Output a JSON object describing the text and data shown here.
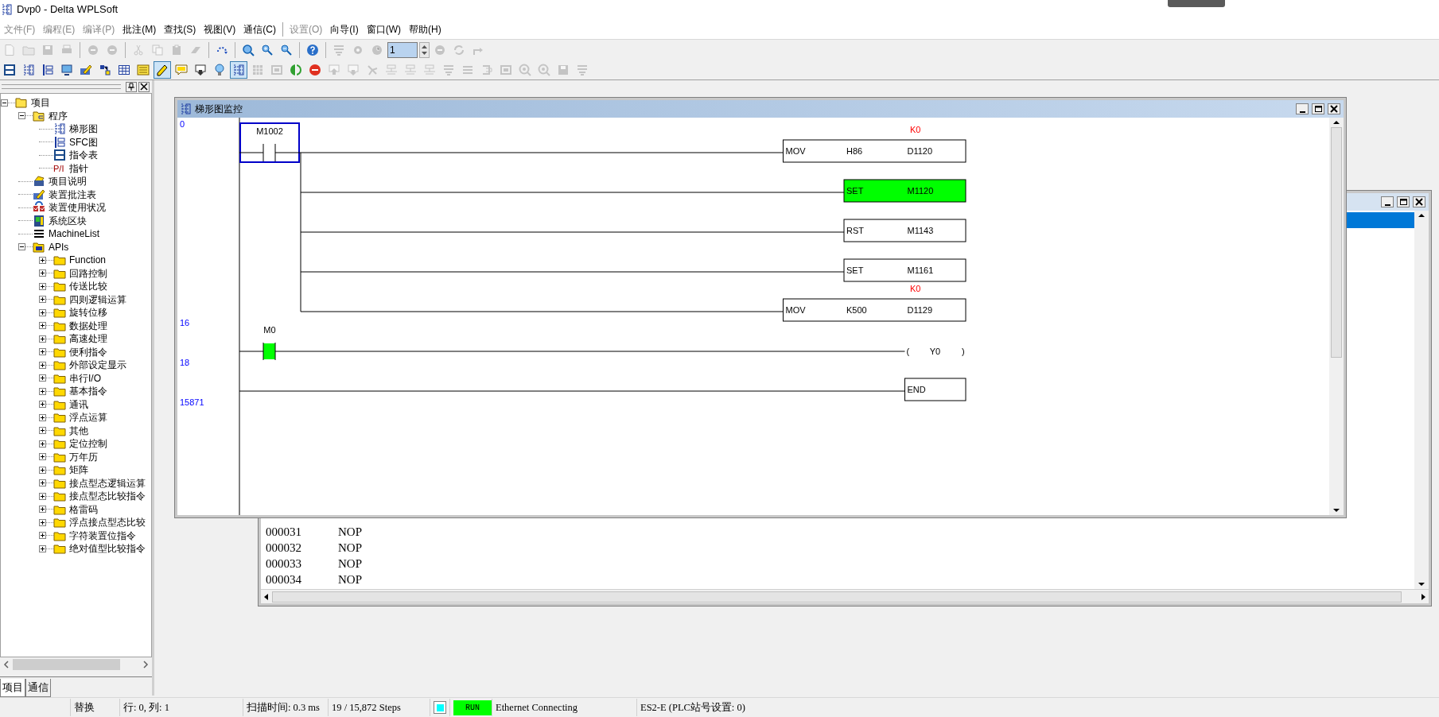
{
  "window": {
    "title": "Dvp0 - Delta WPLSoft"
  },
  "menu": [
    {
      "label": "文件(F)",
      "disabled": true
    },
    {
      "label": "编程(E)",
      "disabled": true
    },
    {
      "label": "编译(P)",
      "disabled": true
    },
    {
      "label": "批注(M)",
      "disabled": false
    },
    {
      "label": "查找(S)",
      "disabled": false
    },
    {
      "label": "视图(V)",
      "disabled": false
    },
    {
      "label": "通信(C)",
      "disabled": false
    },
    {
      "label": "设置(O)",
      "disabled": true
    },
    {
      "label": "向导(I)",
      "disabled": false
    },
    {
      "label": "窗口(W)",
      "disabled": false
    },
    {
      "label": "帮助(H)",
      "disabled": false
    }
  ],
  "toolbars": [
    [
      {
        "kind": "document",
        "disabled": true
      },
      {
        "kind": "folder",
        "disabled": true
      },
      {
        "kind": "floppy",
        "disabled": true
      },
      {
        "kind": "printer",
        "disabled": true
      },
      {
        "kind": "separator"
      },
      {
        "kind": "undo",
        "disabled": true
      },
      {
        "kind": "redo",
        "disabled": true
      },
      {
        "kind": "separator"
      },
      {
        "kind": "scissors",
        "disabled": true
      },
      {
        "kind": "copy",
        "disabled": true
      },
      {
        "kind": "clipboard",
        "disabled": true
      },
      {
        "kind": "eraser",
        "disabled": true
      },
      {
        "kind": "separator"
      },
      {
        "kind": "refresh",
        "disabled": false
      },
      {
        "kind": "separator"
      },
      {
        "kind": "search",
        "disabled": false
      },
      {
        "kind": "zoomin",
        "disabled": false
      },
      {
        "kind": "zoomout",
        "disabled": false
      },
      {
        "kind": "separator"
      },
      {
        "kind": "help",
        "disabled": false
      },
      {
        "kind": "separator"
      },
      {
        "kind": "stack",
        "disabled": true
      },
      {
        "kind": "gear",
        "disabled": true
      },
      {
        "kind": "clock",
        "disabled": true
      },
      {
        "kind": "spin",
        "value": "1"
      },
      {
        "kind": "minus",
        "disabled": true
      },
      {
        "kind": "cycle",
        "disabled": true
      },
      {
        "kind": "arrow",
        "disabled": true
      }
    ],
    [
      {
        "kind": "ldout",
        "disabled": false,
        "pressed": false
      },
      {
        "kind": "ladder",
        "disabled": false,
        "pressed": false
      },
      {
        "kind": "sfc",
        "disabled": false,
        "pressed": false
      },
      {
        "kind": "monitor",
        "disabled": false,
        "pressed": false
      },
      {
        "kind": "pencil",
        "disabled": false,
        "pressed": false
      },
      {
        "kind": "network",
        "disabled": false,
        "pressed": false
      },
      {
        "kind": "table",
        "disabled": false,
        "pressed": false
      },
      {
        "kind": "memo",
        "disabled": false,
        "pressed": false
      },
      {
        "kind": "pen",
        "disabled": false,
        "pressed": true
      },
      {
        "kind": "comment",
        "disabled": false,
        "pressed": false
      },
      {
        "kind": "download",
        "disabled": false,
        "pressed": false
      },
      {
        "kind": "bulb",
        "disabled": false,
        "pressed": false
      },
      {
        "kind": "ladder",
        "disabled": false,
        "pressed": true
      },
      {
        "kind": "grid",
        "disabled": true,
        "pressed": false
      },
      {
        "kind": "image",
        "disabled": true,
        "pressed": false
      },
      {
        "kind": "globe",
        "disabled": false,
        "pressed": false
      },
      {
        "kind": "stop",
        "disabled": false,
        "pressed": false
      },
      {
        "kind": "upload",
        "disabled": true,
        "pressed": false
      },
      {
        "kind": "download",
        "disabled": true,
        "pressed": false
      },
      {
        "kind": "antenna",
        "disabled": true,
        "pressed": false
      },
      {
        "kind": "code",
        "disabled": true,
        "pressed": false
      },
      {
        "kind": "code",
        "disabled": true,
        "pressed": false
      },
      {
        "kind": "code",
        "disabled": true,
        "pressed": false
      },
      {
        "kind": "stack",
        "disabled": true,
        "pressed": false
      },
      {
        "kind": "lines",
        "disabled": true,
        "pressed": false
      },
      {
        "kind": "bracket",
        "disabled": true,
        "pressed": false
      },
      {
        "kind": "image",
        "disabled": true,
        "pressed": false
      },
      {
        "kind": "circle",
        "disabled": true,
        "pressed": false
      },
      {
        "kind": "circle",
        "disabled": true,
        "pressed": false
      },
      {
        "kind": "floppy",
        "disabled": true,
        "pressed": false
      },
      {
        "kind": "stack",
        "disabled": true,
        "pressed": false
      }
    ]
  ],
  "project_panel": {
    "tree": [
      {
        "label": "项目",
        "kind": "openfolder",
        "expanded": true,
        "children": [
          {
            "label": "程序",
            "kind": "program",
            "expanded": true,
            "children": [
              {
                "label": "梯形图",
                "kind": "ladder"
              },
              {
                "label": "SFC图",
                "kind": "sfc"
              },
              {
                "label": "指令表",
                "kind": "ldout"
              },
              {
                "label": "指针",
                "kind": "pointer",
                "badge": "P/I"
              }
            ]
          },
          {
            "label": "项目说明",
            "kind": "note"
          },
          {
            "label": "装置批注表",
            "kind": "pencil"
          },
          {
            "label": "装置使用状况",
            "kind": "status"
          },
          {
            "label": "系统区块",
            "kind": "block"
          },
          {
            "label": "MachineList",
            "kind": "lines"
          },
          {
            "label": "APIs",
            "kind": "apifolder",
            "expanded": true,
            "children": [
              {
                "label": "Function",
                "kind": "folder",
                "expanded": false
              },
              {
                "label": "回路控制",
                "kind": "folder",
                "expanded": false
              },
              {
                "label": "传送比较",
                "kind": "folder",
                "expanded": false
              },
              {
                "label": "四则逻辑运算",
                "kind": "folder",
                "expanded": false
              },
              {
                "label": "旋转位移",
                "kind": "folder",
                "expanded": false
              },
              {
                "label": "数据处理",
                "kind": "folder",
                "expanded": false
              },
              {
                "label": "高速处理",
                "kind": "folder",
                "expanded": false
              },
              {
                "label": "便利指令",
                "kind": "folder",
                "expanded": false
              },
              {
                "label": "外部设定显示",
                "kind": "folder",
                "expanded": false
              },
              {
                "label": "串行I/O",
                "kind": "folder",
                "expanded": false
              },
              {
                "label": "基本指令",
                "kind": "folder",
                "expanded": false
              },
              {
                "label": "通讯",
                "kind": "folder",
                "expanded": false
              },
              {
                "label": "浮点运算",
                "kind": "folder",
                "expanded": false
              },
              {
                "label": "其他",
                "kind": "folder",
                "expanded": false
              },
              {
                "label": "定位控制",
                "kind": "folder",
                "expanded": false
              },
              {
                "label": "万年历",
                "kind": "folder",
                "expanded": false
              },
              {
                "label": "矩阵",
                "kind": "folder",
                "expanded": false
              },
              {
                "label": "接点型态逻辑运算",
                "kind": "folder",
                "expanded": false
              },
              {
                "label": "接点型态比较指令",
                "kind": "folder",
                "expanded": false
              },
              {
                "label": "格雷码",
                "kind": "folder",
                "expanded": false
              },
              {
                "label": "浮点接点型态比较",
                "kind": "folder",
                "expanded": false
              },
              {
                "label": "字符装置位指令",
                "kind": "folder",
                "expanded": false
              },
              {
                "label": "绝对值型比较指令",
                "kind": "folder",
                "expanded": false
              }
            ]
          }
        ]
      }
    ],
    "tabs": [
      {
        "label": "项目",
        "selected": true
      },
      {
        "label": "通信",
        "selected": false
      }
    ]
  },
  "ladder_window": {
    "title": "梯形图监控",
    "rungs": [
      {
        "step": "0",
        "contacts": [
          {
            "label": "M1002",
            "on": false,
            "selected": true
          }
        ],
        "outputs": [
          {
            "kind": "box",
            "cells": [
              "MOV",
              "H86",
              "D1120"
            ],
            "value": "K0",
            "on": false
          },
          {
            "kind": "box",
            "cells": [
              "SET",
              "M1120"
            ],
            "on": true
          },
          {
            "kind": "box",
            "cells": [
              "RST",
              "M1143"
            ],
            "on": false
          },
          {
            "kind": "box",
            "cells": [
              "SET",
              "M1161"
            ],
            "on": false
          },
          {
            "kind": "box",
            "cells": [
              "MOV",
              "K500",
              "D1129"
            ],
            "value": "K0",
            "on": false
          }
        ]
      },
      {
        "step": "16",
        "contacts": [
          {
            "label": "M0",
            "on": true,
            "selected": false
          }
        ],
        "outputs": [
          {
            "kind": "coil",
            "cells": [
              "(",
              "Y0",
              ")"
            ]
          }
        ]
      },
      {
        "step": "18",
        "outputs": [
          {
            "kind": "box",
            "cells": [
              "END"
            ],
            "on": false
          }
        ]
      },
      {
        "step": "15871"
      }
    ]
  },
  "instruction_window": {
    "highlighted_row": true,
    "rows": [
      {
        "address": "000031",
        "instruction": "NOP"
      },
      {
        "address": "000032",
        "instruction": "NOP"
      },
      {
        "address": "000033",
        "instruction": "NOP"
      },
      {
        "address": "000034",
        "instruction": "NOP"
      }
    ]
  },
  "status_bar": [
    {
      "kind": "text",
      "text": "替换"
    },
    {
      "kind": "text",
      "text": "行: 0, 列: 1"
    },
    {
      "kind": "text",
      "text": "扫描时间: 0.3 ms"
    },
    {
      "kind": "text",
      "text": "19 / 15,872 Steps"
    },
    {
      "kind": "indicator",
      "on": true
    },
    {
      "kind": "run",
      "text": "RUN"
    },
    {
      "kind": "text",
      "text": "Ethernet Connecting"
    },
    {
      "kind": "text",
      "text": "ES2-E (PLC站号设置: 0)"
    }
  ]
}
